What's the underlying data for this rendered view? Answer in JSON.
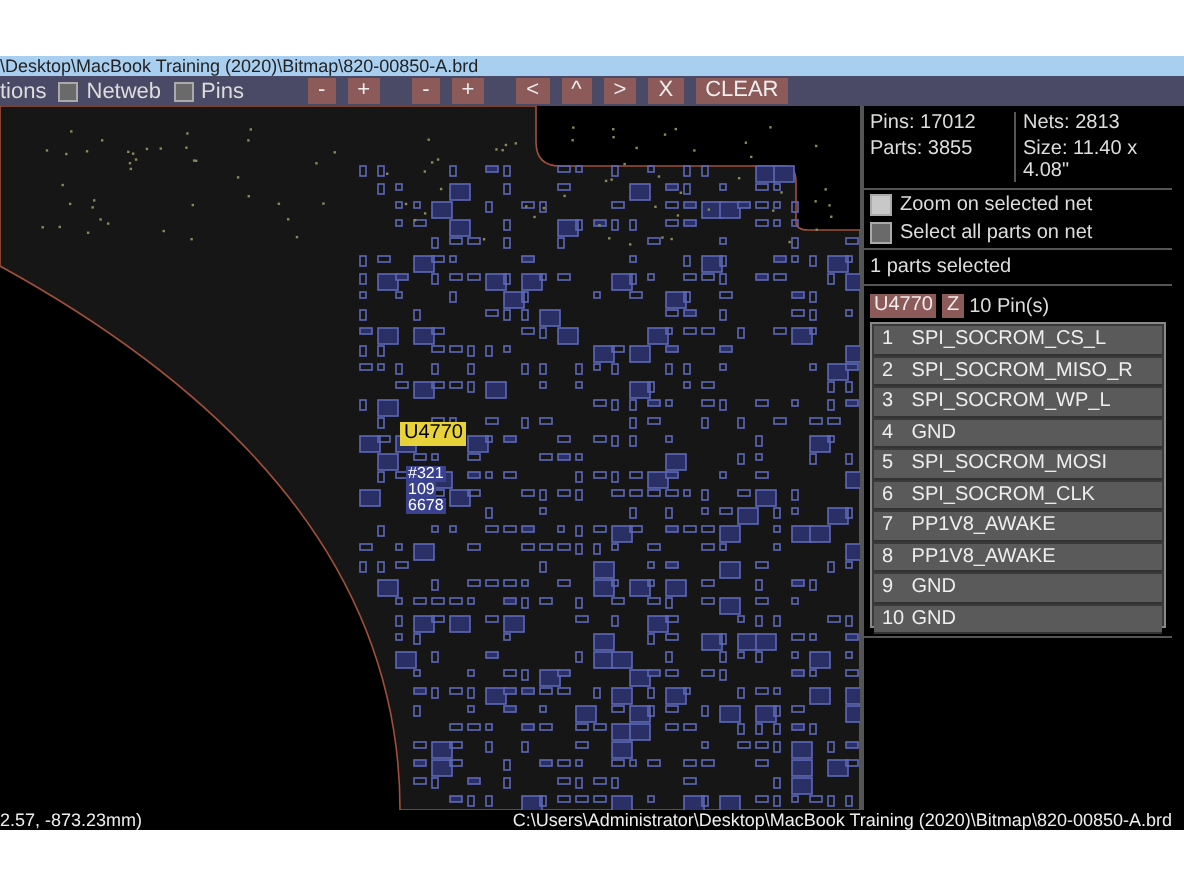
{
  "window": {
    "title": "\\Desktop\\MacBook Training (2020)\\Bitmap\\820-00850-A.brd"
  },
  "toolbar": {
    "options": [
      {
        "label": "tions",
        "kind": "text"
      },
      {
        "label": "Netweb",
        "kind": "checkbox",
        "checked": false
      },
      {
        "label": "Pins",
        "kind": "checkbox",
        "checked": false
      }
    ],
    "button_groups": [
      [
        "-",
        "+"
      ],
      [
        "-",
        "+"
      ],
      [
        "<",
        "^",
        ">",
        "X",
        "CLEAR"
      ]
    ]
  },
  "board": {
    "part_label": "U4770",
    "pin_labels": [
      "#321",
      "109",
      "6678"
    ]
  },
  "info": {
    "pins": "Pins: 17012",
    "parts": "Parts: 3855",
    "nets": "Nets: 2813",
    "size": "Size: 11.40 x 4.08\""
  },
  "net_options": [
    {
      "label": "Zoom on selected net",
      "checked": true
    },
    {
      "label": "Select all parts on net",
      "checked": false
    }
  ],
  "selection": {
    "summary": "1 parts selected",
    "part": "U4770",
    "zoom_button": "Z",
    "pin_count": "10 Pin(s)"
  },
  "pins": [
    {
      "number": "1",
      "net": "SPI_SOCROM_CS_L"
    },
    {
      "number": "2",
      "net": "SPI_SOCROM_MISO_R"
    },
    {
      "number": "3",
      "net": "SPI_SOCROM_WP_L"
    },
    {
      "number": "4",
      "net": "GND"
    },
    {
      "number": "5",
      "net": "SPI_SOCROM_MOSI"
    },
    {
      "number": "6",
      "net": "SPI_SOCROM_CLK"
    },
    {
      "number": "7",
      "net": "PP1V8_AWAKE"
    },
    {
      "number": "8",
      "net": "PP1V8_AWAKE"
    },
    {
      "number": "9",
      "net": "GND"
    },
    {
      "number": "10",
      "net": "GND"
    }
  ],
  "status_bar": {
    "coordinates": "2.57, -873.23mm)",
    "path": "C:\\Users\\Administrator\\Desktop\\MacBook Training (2020)\\Bitmap\\820-00850-A.brd"
  }
}
